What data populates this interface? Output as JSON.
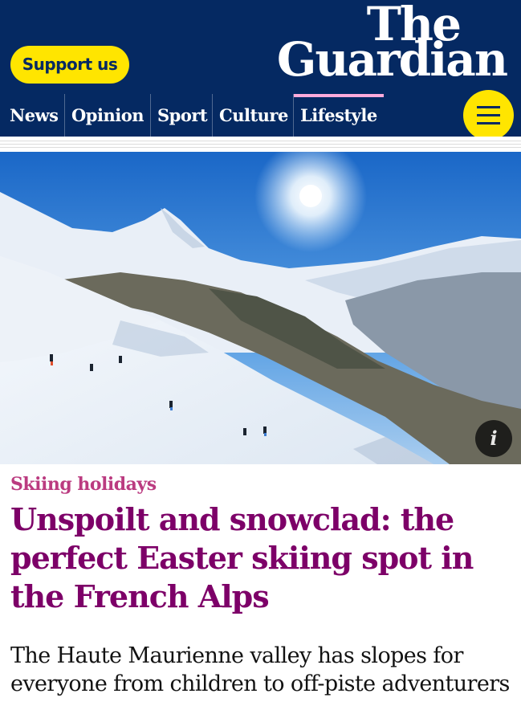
{
  "header": {
    "support_label": "Support us",
    "logo_line1": "The",
    "logo_line2": "Guardian"
  },
  "nav": {
    "items": [
      {
        "label": "News"
      },
      {
        "label": "Opinion"
      },
      {
        "label": "Sport"
      },
      {
        "label": "Culture"
      },
      {
        "label": "Lifestyle",
        "active": true
      }
    ],
    "menu_icon": "hamburger-menu-icon"
  },
  "hero": {
    "info_label": "i",
    "info_icon": "info-icon"
  },
  "article": {
    "kicker": "Skiing holidays",
    "headline": "Unspoilt and snowclad: the perfect Easter skiing spot in the French Alps",
    "standfirst": "The Haute Maurienne valley has slopes for everyone from children to off-piste adventurers"
  },
  "colors": {
    "brand_blue": "#052962",
    "support_yellow": "#ffe500",
    "lifestyle_accent": "#ffabdb",
    "kicker_pink": "#bb3b80",
    "headline_purple": "#7d0068"
  }
}
